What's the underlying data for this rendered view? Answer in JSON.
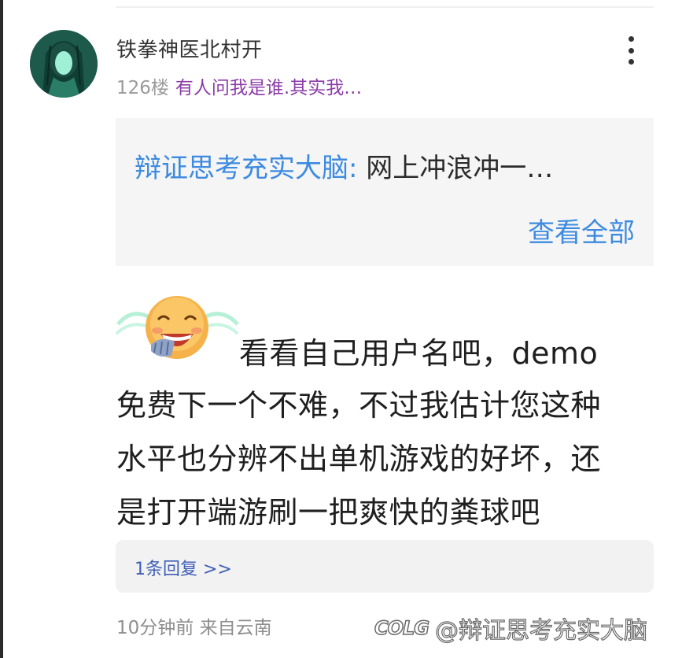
{
  "comment": {
    "username": "铁拳神医北村开",
    "floor": "126楼",
    "floor_quote": "有人问我是谁.其实我…",
    "quoted_reply": {
      "author": "辩证思考充实大脑:",
      "text": " 网上冲浪冲一…",
      "view_all": "查看全部"
    },
    "text_lines": [
      "看看自己用户名吧，demo",
      "免费下一个不难，不过我估计您这种",
      "水平也分辨不出单机游戏的好坏，还",
      "是打开端游刷一把爽快的粪球吧"
    ],
    "emoji": "laughing-crying-emoji",
    "replies_label": "1条回复 >>",
    "meta": "10分钟前 来自云南"
  },
  "watermark": {
    "logo": "COLG",
    "text": "@辩证思考充实大脑"
  },
  "colors": {
    "link_blue": "#3d8be0",
    "quote_purple": "#8c3ca8",
    "reply_blue": "#3f5fb8",
    "muted_gray": "#8e8e8e"
  }
}
